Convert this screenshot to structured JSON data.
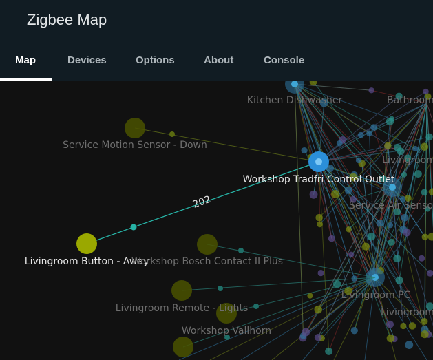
{
  "header": {
    "title": "Zigbee Map"
  },
  "tabs": [
    {
      "label": "Map"
    },
    {
      "label": "Devices"
    },
    {
      "label": "Options"
    },
    {
      "label": "About"
    },
    {
      "label": "Console"
    }
  ],
  "map": {
    "edge_label": "202",
    "nodes": [
      {
        "label": "Kitchen Dishwasher"
      },
      {
        "label": "Bathroom"
      },
      {
        "label": "Service Motion Sensor - Down"
      },
      {
        "label": "Livingroom"
      },
      {
        "label": "Workshop Tradfri Control Outlet"
      },
      {
        "label": "Service Air Sensor"
      },
      {
        "label": "Livingroom Button - Away"
      },
      {
        "label": "Workshop Bosch Contact II Plus"
      },
      {
        "label": "Livingroom Remote - Lights"
      },
      {
        "label": "Workshop Vallhorn"
      },
      {
        "label": "Livingroom PC"
      },
      {
        "label": "Livingroom"
      }
    ],
    "colors": {
      "router": "#2b8fd9",
      "end_device": "#9aa800",
      "link": "#27b3a6"
    }
  }
}
